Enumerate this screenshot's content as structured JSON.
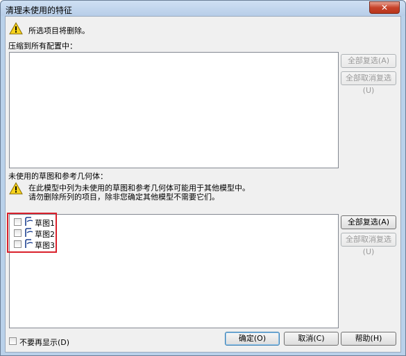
{
  "window": {
    "title": "清理未使用的特征",
    "close_glyph": "✕"
  },
  "top_warning": {
    "text": "所选项目将删除。",
    "icon": "warning-icon"
  },
  "compress": {
    "label": "压缩到所有配置中：",
    "select_all": "全部复选(A)",
    "deselect_all": "全部取消复选(U)"
  },
  "unused": {
    "label": "未使用的草图和参考几何体：",
    "warning_line1": "在此模型中列为未使用的草图和参考几何体可能用于其他模型中。",
    "warning_line2": "请勿删除所列的项目，除非您确定其他模型不需要它们。",
    "items": [
      {
        "label": "草图1",
        "checked": false,
        "icon": "sketch-icon"
      },
      {
        "label": "草图2",
        "checked": false,
        "icon": "sketch-icon"
      },
      {
        "label": "草图3",
        "checked": false,
        "icon": "sketch-icon"
      }
    ],
    "select_all": "全部复选(A)",
    "deselect_all": "全部取消复选(U)"
  },
  "footer": {
    "dont_show": "不要再显示(D)",
    "ok": "确定(O)",
    "cancel": "取消(C)",
    "help": "帮助(H)"
  },
  "colors": {
    "highlight_border": "#d9202b",
    "warning_fill": "#f7d31c"
  }
}
